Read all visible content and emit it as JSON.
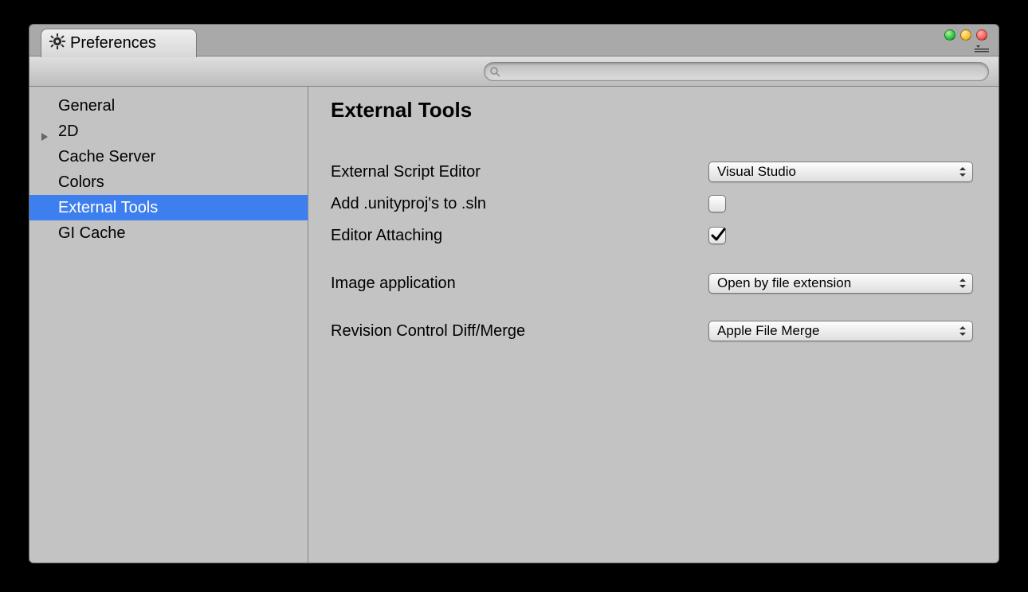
{
  "tab": {
    "title": "Preferences"
  },
  "search": {
    "placeholder": ""
  },
  "sidebar": {
    "items": [
      {
        "label": "General",
        "selected": false,
        "expandable": false
      },
      {
        "label": "2D",
        "selected": false,
        "expandable": true
      },
      {
        "label": "Cache Server",
        "selected": false,
        "expandable": false
      },
      {
        "label": "Colors",
        "selected": false,
        "expandable": false
      },
      {
        "label": "External Tools",
        "selected": true,
        "expandable": false
      },
      {
        "label": "GI Cache",
        "selected": false,
        "expandable": false
      }
    ]
  },
  "content": {
    "title": "External Tools",
    "fields": {
      "external_script_editor": {
        "label": "External Script Editor",
        "value": "Visual Studio"
      },
      "add_unityproj": {
        "label": "Add .unityproj's to .sln",
        "checked": false
      },
      "editor_attaching": {
        "label": "Editor Attaching",
        "checked": true
      },
      "image_application": {
        "label": "Image application",
        "value": "Open by file extension"
      },
      "revision_control": {
        "label": "Revision Control Diff/Merge",
        "value": "Apple File Merge"
      }
    }
  }
}
